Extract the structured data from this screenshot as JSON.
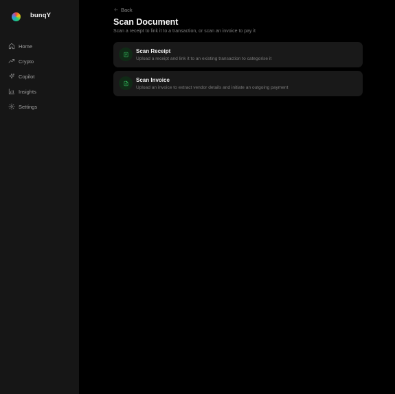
{
  "app": {
    "brand_name": "bunqY",
    "logo_icon": "bunq-rainbow-logo-icon"
  },
  "sidebar": {
    "items": [
      {
        "label": "Home",
        "icon": "home-icon"
      },
      {
        "label": "Crypto",
        "icon": "trending-up-icon"
      },
      {
        "label": "Copilot",
        "icon": "sparkles-icon"
      },
      {
        "label": "Insights",
        "icon": "bar-chart-icon"
      },
      {
        "label": "Settings",
        "icon": "gear-icon"
      }
    ]
  },
  "page": {
    "back_label": "Back",
    "title": "Scan Document",
    "subtitle": "Scan a receipt to link it to a transaction, or scan an invoice to pay it"
  },
  "options": [
    {
      "title": "Scan Receipt",
      "description": "Upload a receipt and link it to an existing transaction to categorise it",
      "icon": "receipt-icon"
    },
    {
      "title": "Scan Invoice",
      "description": "Upload an invoice to extract vendor details and initiate an outgoing payment",
      "icon": "file-text-icon"
    }
  ],
  "colors": {
    "background": "#000000",
    "sidebar": "#161616",
    "card": "#191919",
    "accent": "#37d067",
    "accent_bg": "#102a16"
  }
}
